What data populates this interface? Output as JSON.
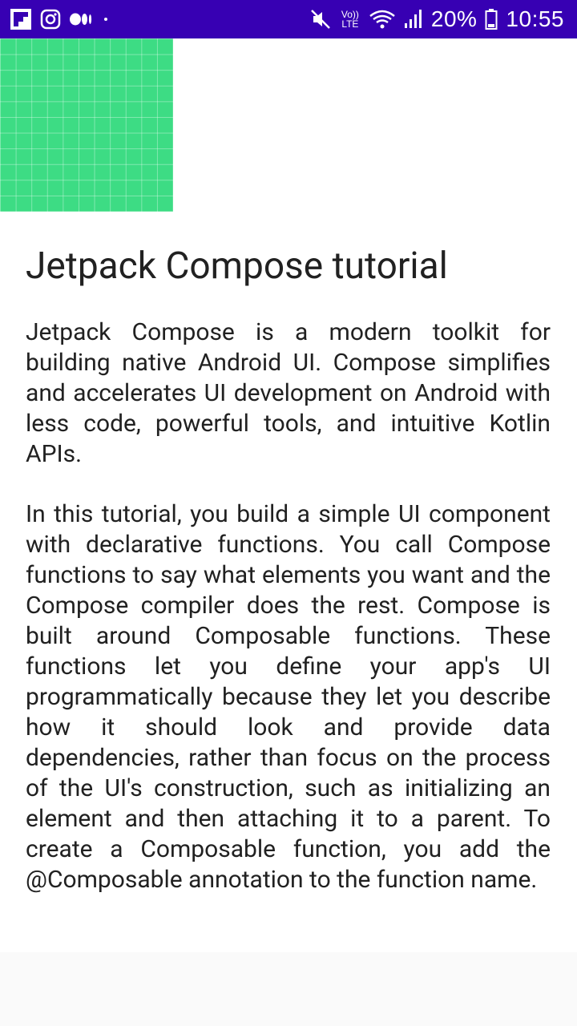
{
  "status_bar": {
    "background": "#3700b3",
    "left_icons": [
      "flipboard-icon",
      "instagram-icon",
      "medium-icon",
      "dot-icon"
    ],
    "right_icons": [
      "mute-icon",
      "volte-icon",
      "wifi-icon",
      "signal-icon",
      "battery-icon"
    ],
    "volte_line1": "Vo))",
    "volte_line2": "LTE",
    "battery": "20%",
    "time": "10:55"
  },
  "content": {
    "header_image": {
      "color": "#3ddc84"
    },
    "title": "Jetpack Compose tutorial",
    "paragraphs": [
      "Jetpack Compose is a modern toolkit for building native Android UI. Compose simplifies and accelerates UI development on Android with less code, powerful tools, and intuitive Kotlin APIs.",
      "In this tutorial, you build a simple UI component with declarative functions. You call Compose functions to say what elements you want and the Compose compiler does the rest. Compose is built around Composable functions. These functions let you define your app's UI programmatically because they let you describe how it should look and provide data dependencies, rather than focus on the process of the UI's construction, such as initializing an element and then attaching it to a parent. To create a Composable function, you add the @Composable annotation to the function name."
    ]
  }
}
